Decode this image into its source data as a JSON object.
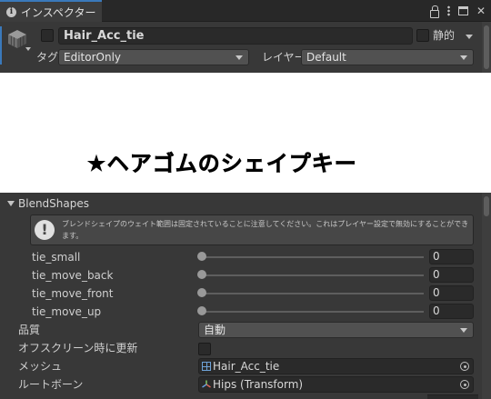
{
  "tab": {
    "label": "インスペクター",
    "icon": "info-icon"
  },
  "tab_actions": [
    "lock-icon",
    "kebab-menu-icon",
    "maximize-icon",
    "close-icon"
  ],
  "object": {
    "name": "Hair_Acc_tie",
    "active": false,
    "static_label": "静的",
    "static": false,
    "tag_label": "タグ",
    "tag_value": "EditorOnly",
    "layer_label": "レイヤー",
    "layer_value": "Default"
  },
  "heading": "★ヘアゴムのシェイプキー",
  "blendshapes": {
    "title": "BlendShapes",
    "help_text": "ブレンドシェイプのウェイト範囲は固定されていることに注意してください。これはプレイヤー設定で無効にすることができます。",
    "items": [
      {
        "label": "tie_small",
        "value": "0"
      },
      {
        "label": "tie_move_back",
        "value": "0"
      },
      {
        "label": "tie_move_front",
        "value": "0"
      },
      {
        "label": "tie_move_up",
        "value": "0"
      }
    ]
  },
  "properties": {
    "quality_label": "品質",
    "quality_value": "自動",
    "offscreen_label": "オフスクリーン時に更新",
    "offscreen_checked": false,
    "mesh_label": "メッシュ",
    "mesh_value": "Hair_Acc_tie",
    "rootbone_label": "ルートボーン",
    "rootbone_value": "Hips (Transform)"
  },
  "colors": {
    "panel_bg": "#383838",
    "accent": "#3a79bb",
    "field_bg": "#2a2a2a"
  }
}
